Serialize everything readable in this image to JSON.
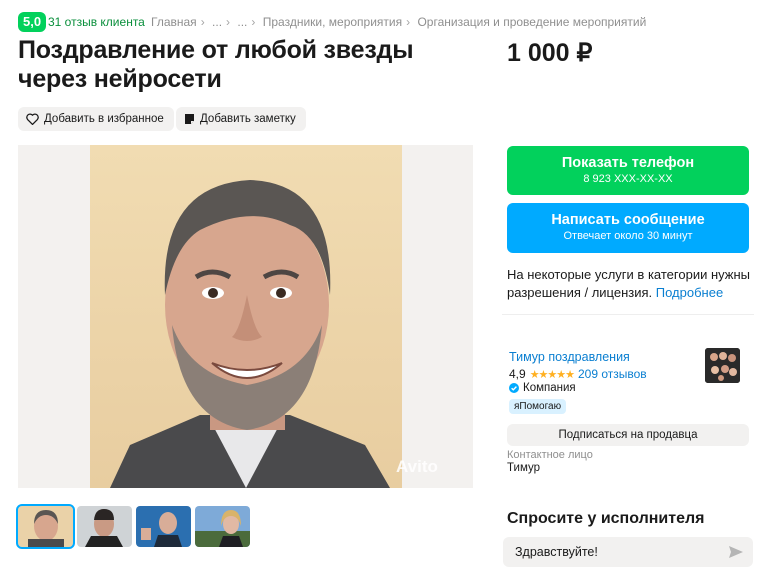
{
  "rating": {
    "score": "5,0",
    "reviews_label": "31 отзыв клиента"
  },
  "breadcrumbs": [
    "Главная",
    "...",
    "...",
    "Праздники, мероприятия",
    "Организация и проведение мероприятий"
  ],
  "listing": {
    "title": "Поздравление от любой звезды через нейросети",
    "price": "1 000 ₽",
    "fav_label": "Добавить в избранное",
    "note_label": "Добавить заметку",
    "watermark": "Avito"
  },
  "contact": {
    "phone_label": "Показать телефон",
    "phone_masked": "8 923 XXX-XX-XX",
    "message_label": "Написать сообщение",
    "message_sub": "Отвечает около 30 минут",
    "license_text": "На некоторые услуги в категории нужны разрешения / лицензия.",
    "license_link": "Подробнее"
  },
  "seller": {
    "name": "Тимур поздравления",
    "rating": "4,9",
    "stars": "★★★★★",
    "reviews": "209 отзывов",
    "type": "Компания",
    "badge": "яПомогаю",
    "subscribe_label": "Подписаться на продавца",
    "contact_label": "Контактное лицо",
    "contact_name": "Тимур"
  },
  "ask": {
    "title": "Спросите у исполнителя",
    "input_value": "Здравствуйте!"
  },
  "colors": {
    "green": "#02d15c",
    "blue": "#00aaff",
    "link": "#0a7fd1"
  }
}
